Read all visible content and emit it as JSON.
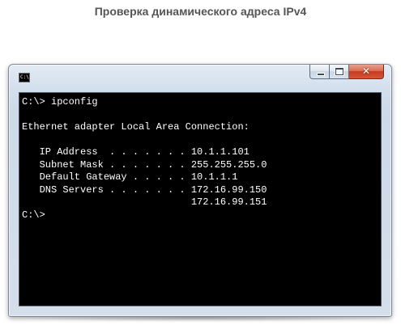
{
  "page": {
    "title": "Проверка динамического адреса IPv4"
  },
  "window": {
    "icon": {
      "name": "console-icon",
      "glyph": "C:\\"
    },
    "controls": {
      "close_glyph": "✕"
    },
    "console": {
      "lines": [
        "C:\\> ipconfig",
        "",
        "Ethernet adapter Local Area Connection:",
        "",
        "   IP Address  . . . . . . . 10.1.1.101",
        "   Subnet Mask . . . . . . . 255.255.255.0",
        "   Default Gateway . . . . . 10.1.1.1",
        "   DNS Servers . . . . . . . 172.16.99.150",
        "                             172.16.99.151",
        "C:\\>"
      ]
    }
  },
  "colors": {
    "console_background": "#000000",
    "console_text": "#ffffff",
    "title_text": "#555555",
    "close_button": "#c53b1d"
  }
}
